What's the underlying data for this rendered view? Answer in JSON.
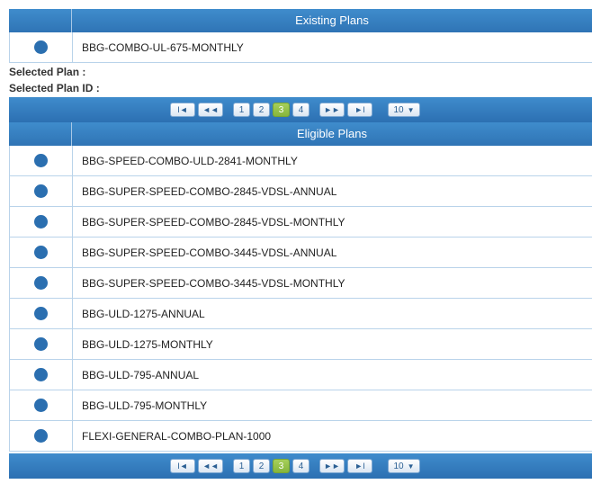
{
  "existing": {
    "header": "Existing Plans",
    "plans": [
      "BBG-COMBO-UL-675-MONTHLY"
    ]
  },
  "selected_plan_label": "Selected Plan :",
  "selected_plan_id_label": "Selected Plan ID :",
  "pager": {
    "first": "I◄",
    "prev": "◄◄",
    "next": "►►",
    "last": "►I",
    "pages": [
      "1",
      "2",
      "3",
      "4"
    ],
    "current_page": "3",
    "page_size": "10"
  },
  "eligible": {
    "header": "Eligible Plans",
    "plans": [
      "BBG-SPEED-COMBO-ULD-2841-MONTHLY",
      "BBG-SUPER-SPEED-COMBO-2845-VDSL-ANNUAL",
      "BBG-SUPER-SPEED-COMBO-2845-VDSL-MONTHLY",
      "BBG-SUPER-SPEED-COMBO-3445-VDSL-ANNUAL",
      "BBG-SUPER-SPEED-COMBO-3445-VDSL-MONTHLY",
      "BBG-ULD-1275-ANNUAL",
      "BBG-ULD-1275-MONTHLY",
      "BBG-ULD-795-ANNUAL",
      "BBG-ULD-795-MONTHLY",
      "FLEXI-GENERAL-COMBO-PLAN-1000"
    ]
  }
}
